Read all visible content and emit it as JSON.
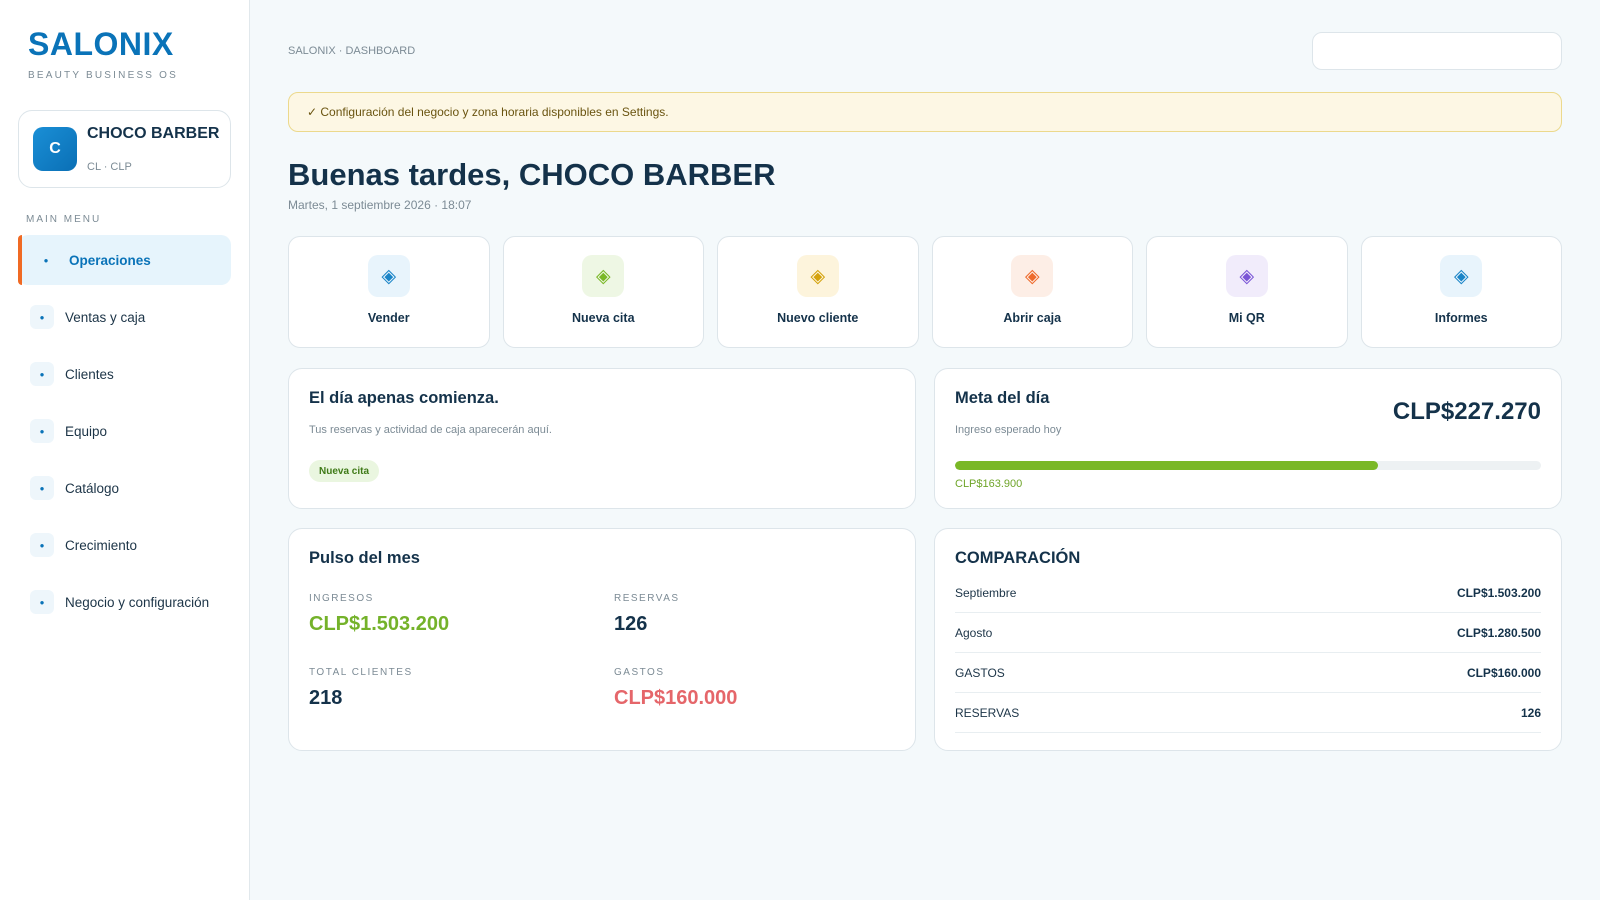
{
  "sidebar": {
    "brand": "SALONIX",
    "brand_sub": "BEAUTY BUSINESS OS",
    "business": {
      "initial": "C",
      "name": "CHOCO BARBER",
      "meta": "CL · CLP"
    },
    "menu_title": "MAIN MENU",
    "items": [
      {
        "label": "Operaciones",
        "active": true
      },
      {
        "label": "Ventas y caja"
      },
      {
        "label": "Clientes"
      },
      {
        "label": "Equipo"
      },
      {
        "label": "Catálogo"
      },
      {
        "label": "Crecimiento"
      },
      {
        "label": "Negocio y configuración"
      }
    ]
  },
  "header": {
    "breadcrumb": "SALONIX · DASHBOARD",
    "search_value": ""
  },
  "notice": "✓ Configuración del negocio y zona horaria disponibles en Settings.",
  "greeting": "Buenas tardes, CHOCO BARBER",
  "date": "Martes, 1 septiembre 2026 · 18:07",
  "quick_actions": [
    {
      "label": "Vender",
      "icon": "diamond-icon",
      "color": "#1a84c7",
      "bg": "#e8f4fc"
    },
    {
      "label": "Nueva cita",
      "icon": "diamond-icon",
      "color": "#7ab827",
      "bg": "#eef7e4"
    },
    {
      "label": "Nuevo cliente",
      "icon": "diamond-icon",
      "color": "#d4a20c",
      "bg": "#fdf4dc"
    },
    {
      "label": "Abrir caja",
      "icon": "diamond-icon",
      "color": "#ee6a2c",
      "bg": "#fdeee6"
    },
    {
      "label": "Mi QR",
      "icon": "diamond-icon",
      "color": "#7a55d6",
      "bg": "#f1ecfb"
    },
    {
      "label": "Informes",
      "icon": "diamond-icon",
      "color": "#1a84c7",
      "bg": "#e8f4fc"
    }
  ],
  "day_card": {
    "title": "El día apenas comienza.",
    "subtitle": "Tus reservas y actividad de caja aparecerán aquí.",
    "chip": "Nueva cita"
  },
  "goal_card": {
    "title": "Meta del día",
    "subtitle": "Ingreso esperado hoy",
    "amount": "CLP$227.270",
    "current": "CLP$163.900",
    "progress_fraction": 0.721
  },
  "pulse_card": {
    "title": "Pulso del mes",
    "stats": [
      {
        "label": "INGRESOS",
        "value": "CLP$1.503.200",
        "tone": "green"
      },
      {
        "label": "RESERVAS",
        "value": "126",
        "tone": ""
      },
      {
        "label": "TOTAL CLIENTES",
        "value": "218",
        "tone": ""
      },
      {
        "label": "GASTOS",
        "value": "CLP$160.000",
        "tone": "red"
      }
    ]
  },
  "comparison_card": {
    "title": "COMPARACIÓN",
    "rows": [
      {
        "name": "Septiembre",
        "amount": "CLP$1.503.200"
      },
      {
        "name": "Agosto",
        "amount": "CLP$1.280.500"
      },
      {
        "name": "GASTOS",
        "amount": "CLP$160.000"
      },
      {
        "name": "RESERVAS",
        "amount": "126"
      }
    ]
  }
}
